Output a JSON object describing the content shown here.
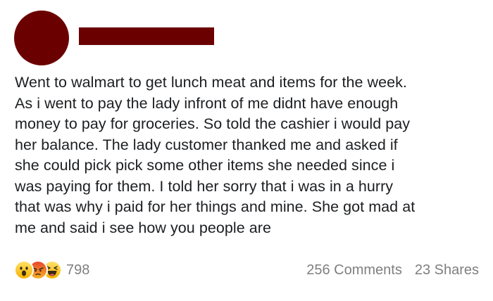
{
  "post": {
    "author_name": "",
    "colors": {
      "redaction": "#6b0000",
      "text": "#1c1e21",
      "meta": "#7f7f7f"
    },
    "text": "Went to walmart to get lunch meat and items for the week.\nAs i went to pay the lady infront of me didnt have enough\nmoney to pay for groceries. So told the cashier i would pay\nher balance. The lady customer thanked me and asked if\nshe could pick pick some other items she needed since i\nwas paying for them. I told her sorry that i was in a hurry\nthat was why i paid for her things and mine. She got mad at\nme and said i see how you people are"
  },
  "footer": {
    "reactions": [
      {
        "name": "wow-reaction-icon"
      },
      {
        "name": "angry-reaction-icon"
      },
      {
        "name": "haha-reaction-icon"
      }
    ],
    "reaction_count": "798",
    "comments": "256 Comments",
    "shares": "23 Shares"
  }
}
